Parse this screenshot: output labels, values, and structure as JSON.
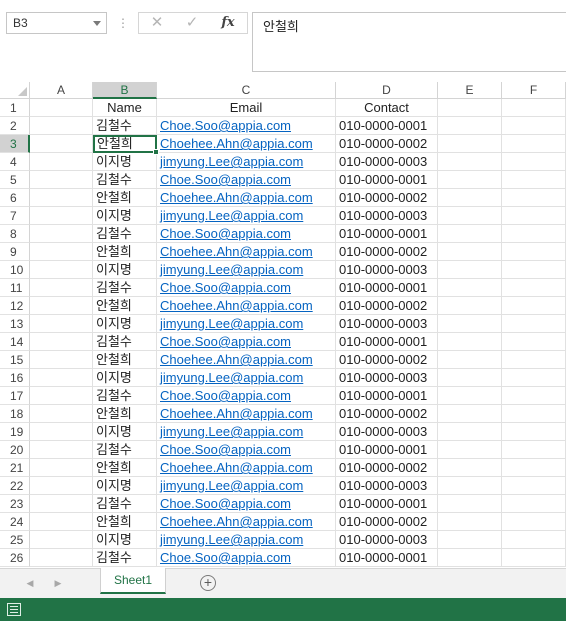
{
  "formula_bar": {
    "name_box": "B3",
    "dots": "⋮",
    "cancel_glyph": "✕",
    "enter_glyph": "✓",
    "fx_label": "fx",
    "formula_value": "안철희"
  },
  "grid": {
    "columns": [
      "A",
      "B",
      "C",
      "D",
      "E",
      "F"
    ],
    "active_column": "B",
    "active_row": 3,
    "rows": [
      {
        "num": "1",
        "name": "Name",
        "email": "Email",
        "contact": "Contact",
        "header": true
      },
      {
        "num": "2",
        "name": "김철수",
        "email": "Choe.Soo@appia.com",
        "contact": "010-0000-0001"
      },
      {
        "num": "3",
        "name": "안철희",
        "email": "Choehee.Ahn@appia.com",
        "contact": "010-0000-0002"
      },
      {
        "num": "4",
        "name": "이지명",
        "email": "jimyung.Lee@appia.com",
        "contact": "010-0000-0003"
      },
      {
        "num": "5",
        "name": "김철수",
        "email": "Choe.Soo@appia.com",
        "contact": "010-0000-0001"
      },
      {
        "num": "6",
        "name": "안철희",
        "email": "Choehee.Ahn@appia.com",
        "contact": "010-0000-0002"
      },
      {
        "num": "7",
        "name": "이지명",
        "email": "jimyung.Lee@appia.com",
        "contact": "010-0000-0003"
      },
      {
        "num": "8",
        "name": "김철수",
        "email": "Choe.Soo@appia.com",
        "contact": "010-0000-0001"
      },
      {
        "num": "9",
        "name": "안철희",
        "email": "Choehee.Ahn@appia.com",
        "contact": "010-0000-0002"
      },
      {
        "num": "10",
        "name": "이지명",
        "email": "jimyung.Lee@appia.com",
        "contact": "010-0000-0003"
      },
      {
        "num": "11",
        "name": "김철수",
        "email": "Choe.Soo@appia.com",
        "contact": "010-0000-0001"
      },
      {
        "num": "12",
        "name": "안철희",
        "email": "Choehee.Ahn@appia.com",
        "contact": "010-0000-0002"
      },
      {
        "num": "13",
        "name": "이지명",
        "email": "jimyung.Lee@appia.com",
        "contact": "010-0000-0003"
      },
      {
        "num": "14",
        "name": "김철수",
        "email": "Choe.Soo@appia.com",
        "contact": "010-0000-0001"
      },
      {
        "num": "15",
        "name": "안철희",
        "email": "Choehee.Ahn@appia.com",
        "contact": "010-0000-0002"
      },
      {
        "num": "16",
        "name": "이지명",
        "email": "jimyung.Lee@appia.com",
        "contact": "010-0000-0003"
      },
      {
        "num": "17",
        "name": "김철수",
        "email": "Choe.Soo@appia.com",
        "contact": "010-0000-0001"
      },
      {
        "num": "18",
        "name": "안철희",
        "email": "Choehee.Ahn@appia.com",
        "contact": "010-0000-0002"
      },
      {
        "num": "19",
        "name": "이지명",
        "email": "jimyung.Lee@appia.com",
        "contact": "010-0000-0003"
      },
      {
        "num": "20",
        "name": "김철수",
        "email": "Choe.Soo@appia.com",
        "contact": "010-0000-0001"
      },
      {
        "num": "21",
        "name": "안철희",
        "email": "Choehee.Ahn@appia.com",
        "contact": "010-0000-0002"
      },
      {
        "num": "22",
        "name": "이지명",
        "email": "jimyung.Lee@appia.com",
        "contact": "010-0000-0003"
      },
      {
        "num": "23",
        "name": "김철수",
        "email": "Choe.Soo@appia.com",
        "contact": "010-0000-0001"
      },
      {
        "num": "24",
        "name": "안철희",
        "email": "Choehee.Ahn@appia.com",
        "contact": "010-0000-0002"
      },
      {
        "num": "25",
        "name": "이지명",
        "email": "jimyung.Lee@appia.com",
        "contact": "010-0000-0003"
      },
      {
        "num": "26",
        "name": "김철수",
        "email": "Choe.Soo@appia.com",
        "contact": "010-0000-0001"
      }
    ]
  },
  "sheet_tabs": {
    "prev_glyph": "◀",
    "next_glyph": "▶",
    "active_tab": "Sheet1",
    "add_glyph": "+"
  },
  "colors": {
    "accent": "#217346",
    "link": "#0563c1"
  }
}
